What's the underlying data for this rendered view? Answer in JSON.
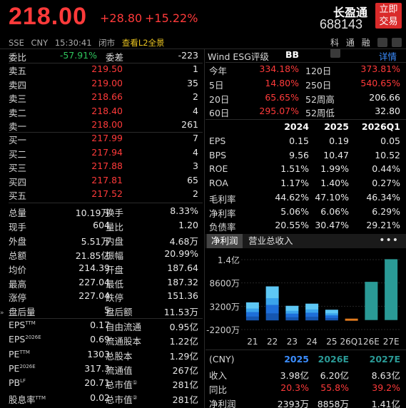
{
  "header": {
    "price": "218.00",
    "change": "+28.80",
    "change_pct": "+15.22%",
    "name": "长盈通",
    "code": "688143",
    "trade_button": "立即\n交易",
    "trade_line1": "立即",
    "trade_line2": "交易",
    "exchange": "SSE",
    "currency": "CNY",
    "time": "15:30:41",
    "status": "闭市",
    "l2_link": "查看L2全景",
    "right_labels": [
      "科",
      "通",
      "融"
    ]
  },
  "order_book": {
    "ratio_label": "委比",
    "ratio_value": "-57.91%",
    "diff_label": "委差",
    "diff_value": "-223",
    "asks": [
      {
        "label": "卖五",
        "price": "219.50",
        "vol": "1"
      },
      {
        "label": "卖四",
        "price": "219.00",
        "vol": "35"
      },
      {
        "label": "卖三",
        "price": "218.66",
        "vol": "2"
      },
      {
        "label": "卖二",
        "price": "218.40",
        "vol": "4"
      },
      {
        "label": "卖一",
        "price": "218.00",
        "vol": "261"
      }
    ],
    "bids": [
      {
        "label": "买一",
        "price": "217.99",
        "vol": "7"
      },
      {
        "label": "买二",
        "price": "217.94",
        "vol": "4"
      },
      {
        "label": "买三",
        "price": "217.88",
        "vol": "3"
      },
      {
        "label": "买四",
        "price": "217.81",
        "vol": "65"
      },
      {
        "label": "买五",
        "price": "217.52",
        "vol": "2"
      }
    ]
  },
  "stats": [
    {
      "l1": "总量",
      "v1": "10.19万",
      "c1": "white",
      "l2": "换手",
      "v2": "8.33%",
      "c2": "white"
    },
    {
      "l1": "现手",
      "v1": "604",
      "c1": "white",
      "l2": "量比",
      "v2": "1.20",
      "c2": "white"
    },
    {
      "l1": "外盘",
      "v1": "5.51万",
      "c1": "red",
      "l2": "内盘",
      "v2": "4.68万",
      "c2": "green"
    },
    {
      "l1": "总额",
      "v1": "21.85亿",
      "c1": "white",
      "l2": "振幅",
      "v2": "20.99%",
      "c2": "white"
    },
    {
      "l1": "均价",
      "v1": "214.39",
      "c1": "red",
      "l2": "开盘",
      "v2": "187.64",
      "c2": "green"
    },
    {
      "l1": "最高",
      "v1": "227.04",
      "c1": "red",
      "l2": "最低",
      "v2": "187.32",
      "c2": "green"
    },
    {
      "l1": "涨停",
      "v1": "227.04",
      "c1": "red",
      "l2": "跌停",
      "v2": "151.36",
      "c2": "green"
    },
    {
      "l1": "盘后量",
      "v1": "5",
      "c1": "white",
      "l2": "盘后额",
      "v2": "11.53万",
      "c2": "white"
    }
  ],
  "fundamentals": [
    {
      "l1": "EPS",
      "sup1": "TTM",
      "v1": "0.17",
      "l2": "自由流通",
      "v2": "0.95亿"
    },
    {
      "l1": "EPS",
      "sup1": "2026E",
      "v1": "0.69",
      "l2": "流通股本",
      "v2": "1.22亿"
    },
    {
      "l1": "PE",
      "sup1": "TTM",
      "v1": "1303",
      "l2": "总股本",
      "v2": "1.29亿"
    },
    {
      "l1": "PE",
      "sup1": "2026E",
      "v1": "317.3",
      "l2": "流通值",
      "v2": "267亿"
    },
    {
      "l1": "PB",
      "sup1": "LF",
      "v1": "20.71",
      "l2": "总市值",
      "sup2": "①",
      "v2": "281亿"
    },
    {
      "l1": "股息率",
      "sup1": "TTM",
      "v1": "0.02",
      "l2": "总市值",
      "sup2": "②",
      "v2": "281亿"
    }
  ],
  "esg": {
    "label": "Wind ESG评级",
    "grade": "BB",
    "detail": "详情"
  },
  "performance": [
    {
      "a": "今年",
      "b": "334.18%",
      "c": "120日",
      "d": "373.81%"
    },
    {
      "a": "5日",
      "b": "14.80%",
      "c": "250日",
      "d": "540.65%"
    },
    {
      "a": "20日",
      "b": "65.65%",
      "c": "52周高",
      "d": "206.66"
    },
    {
      "a": "60日",
      "b": "295.07%",
      "c": "52周低",
      "d": "32.80"
    }
  ],
  "fin_table": {
    "headers": [
      "2024",
      "2025",
      "2026Q1"
    ],
    "rows": [
      {
        "name": "EPS",
        "v": [
          "0.15",
          "0.19",
          "0.05"
        ]
      },
      {
        "name": "BPS",
        "v": [
          "9.56",
          "10.47",
          "10.52"
        ]
      },
      {
        "name": "ROE",
        "v": [
          "1.51%",
          "1.99%",
          "0.44%"
        ]
      },
      {
        "name": "ROA",
        "v": [
          "1.17%",
          "1.40%",
          "0.27%"
        ]
      },
      {
        "name": "毛利率",
        "v": [
          "44.62%",
          "47.10%",
          "46.34%"
        ]
      },
      {
        "name": "净利率",
        "v": [
          "5.06%",
          "6.06%",
          "6.29%"
        ]
      },
      {
        "name": "负债率",
        "v": [
          "20.55%",
          "30.47%",
          "29.21%"
        ]
      }
    ]
  },
  "chart_tabs": {
    "active": "净利润",
    "other": "营业总收入",
    "more": "•••"
  },
  "chart_data": {
    "type": "bar",
    "categories": [
      "21",
      "22",
      "23",
      "24",
      "25",
      "26Q1",
      "26E",
      "27E"
    ],
    "values": [
      4100,
      7800,
      3300,
      3800,
      2393,
      -500,
      8858,
      14100
    ],
    "ytick_labels": [
      "1.4亿",
      "8600万",
      "3200万",
      "-2200万"
    ],
    "ytick_values": [
      14000,
      8600,
      3200,
      -2200
    ],
    "ylim": [
      -2200,
      14000
    ],
    "colors": {
      "actual": "#1e6fd9",
      "actual_light": "#5ec8f5",
      "quarter": "#e07a1e",
      "estimate": "#2a9a96"
    }
  },
  "forecast": {
    "headers": [
      "(CNY)",
      "2025",
      "2026E",
      "2027E"
    ],
    "rows": [
      {
        "name": "收入",
        "v": [
          "3.98亿",
          "6.20亿",
          "8.63亿"
        ],
        "c": "white"
      },
      {
        "name": "同比",
        "v": [
          "20.3%",
          "55.8%",
          "39.2%"
        ],
        "c": "red"
      },
      {
        "name": "净利润",
        "v": [
          "2393万",
          "8858万",
          "1.41亿"
        ],
        "c": "white"
      }
    ]
  }
}
